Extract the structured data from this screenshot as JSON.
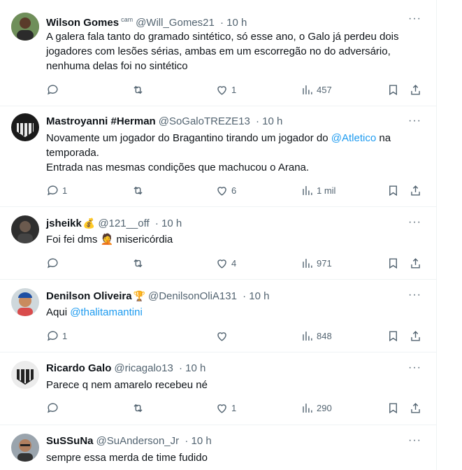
{
  "tweets": [
    {
      "name": "Wilson Gomes",
      "badge": "cam",
      "emoji": "",
      "handle": "@Will_Gomes21",
      "time": "· 10 h",
      "text_lines": [
        "A galera fala tanto do gramado sintético, só esse ano, o Galo já perdeu dois",
        "jogadores com lesões sérias, ambas em um escorregão no do adversário,",
        "nenhuma delas foi no sintético"
      ],
      "replies": "",
      "retweets": "",
      "likes": "1",
      "views": "457"
    },
    {
      "name": "Mastroyanni #Herman",
      "badge": "",
      "emoji": "",
      "handle": "@SoGaloTREZE13",
      "time": "· 10 h",
      "text_lines": [
        "Novamente um jogador do Bragantino tirando um jogador do",
        "temporada.",
        "Entrada nas mesmas condições que machucou o Arana."
      ],
      "mention": "@Atletico",
      "mention_tail": " na",
      "replies": "1",
      "retweets": "",
      "likes": "6",
      "views": "1 mil"
    },
    {
      "name": "jsheikk",
      "badge": "",
      "emoji": "💰",
      "handle": "@121__off",
      "time": "· 10 h",
      "text_lines": [
        "Foi fei dms",
        "misericórdia"
      ],
      "inline_emoji": "🤦",
      "replies": "",
      "retweets": "",
      "likes": "4",
      "views": "971"
    },
    {
      "name": "Denilson Oliveira",
      "badge": "",
      "emoji": "🏆",
      "handle": "@DenilsonOliA131",
      "time": "· 10 h",
      "text_prefix": "Aqui ",
      "mention": "@thalitamantini",
      "replies": "1",
      "retweets": "",
      "likes": "",
      "views": "848"
    },
    {
      "name": "Ricardo Galo",
      "badge": "",
      "emoji": "",
      "handle": "@ricagalo13",
      "time": "· 10 h",
      "text_lines": [
        "Parece q nem amarelo recebeu né"
      ],
      "replies": "",
      "retweets": "",
      "likes": "1",
      "views": "290"
    },
    {
      "name": "SuSSuNa",
      "badge": "",
      "emoji": "",
      "handle": "@SuAnderson_Jr",
      "time": "· 10 h",
      "text_lines": [
        "sempre essa merda de time fudido"
      ]
    }
  ],
  "more_label": "···",
  "colors": {
    "text": "#0f1419",
    "secondary": "#536471",
    "link": "#1d9bf0",
    "divider": "#eff3f4"
  },
  "icons": [
    "reply-icon",
    "retweet-icon",
    "like-icon",
    "views-icon",
    "bookmark-icon",
    "share-icon",
    "more-icon"
  ]
}
